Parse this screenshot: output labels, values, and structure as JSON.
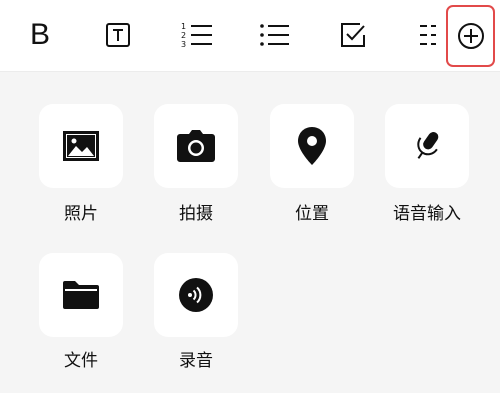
{
  "toolbar": {
    "bold_label": "B",
    "tools": [
      {
        "name": "bold",
        "icon": "bold-icon"
      },
      {
        "name": "text-style",
        "icon": "text-box-icon"
      },
      {
        "name": "numbered-list",
        "icon": "numbered-list-icon"
      },
      {
        "name": "bulleted-list",
        "icon": "bulleted-list-icon"
      },
      {
        "name": "checklist",
        "icon": "checkbox-icon"
      },
      {
        "name": "divider",
        "icon": "dashed-list-icon"
      },
      {
        "name": "add-attachment",
        "icon": "plus-circle-icon"
      }
    ],
    "highlight_color": "#e24a4a"
  },
  "attachments": {
    "items": [
      {
        "label": "照片",
        "icon": "image-icon"
      },
      {
        "label": "拍摄",
        "icon": "camera-icon"
      },
      {
        "label": "位置",
        "icon": "location-pin-icon"
      },
      {
        "label": "语音输入",
        "icon": "microphone-icon"
      },
      {
        "label": "文件",
        "icon": "folder-icon"
      },
      {
        "label": "录音",
        "icon": "audio-record-icon"
      }
    ]
  }
}
